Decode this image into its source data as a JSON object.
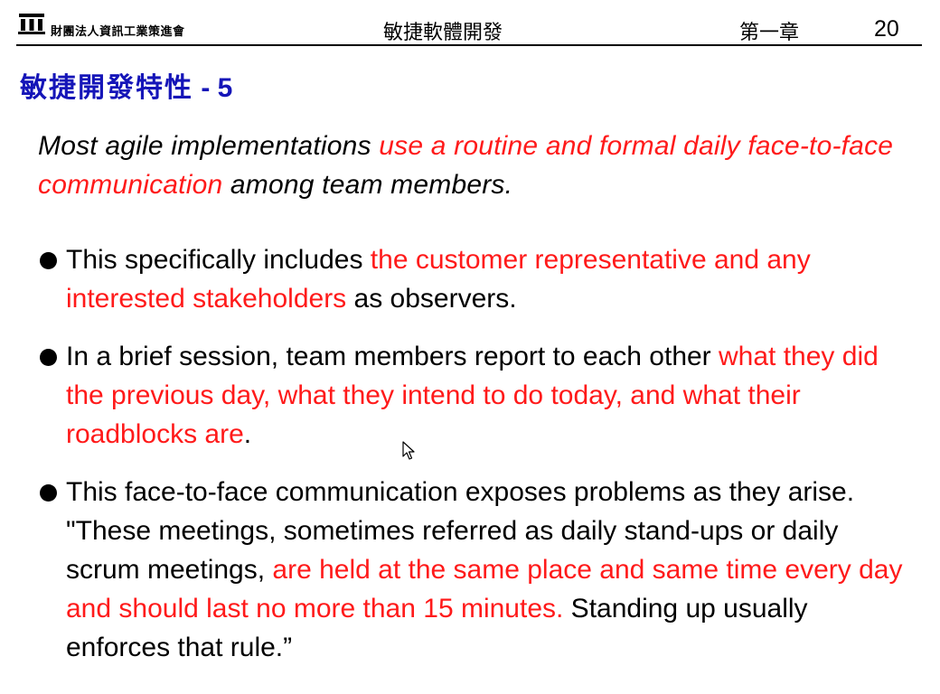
{
  "header": {
    "org_name": "財團法人資訊工業策進會",
    "course_title": "敏捷軟體開發",
    "chapter": "第一章",
    "page_number": "20"
  },
  "slide": {
    "title_zh": "敏捷開發特性",
    "title_suffix": " - 5",
    "intro": [
      {
        "text": "Most agile implementations ",
        "highlight": false
      },
      {
        "text": "use a routine and formal daily face-to-face communication",
        "highlight": true
      },
      {
        "text": " among team members.",
        "highlight": false
      }
    ],
    "bullets": [
      [
        {
          "text": "This specifically includes ",
          "highlight": false
        },
        {
          "text": "the customer representative and any interested stakeholders",
          "highlight": true
        },
        {
          "text": " as observers.",
          "highlight": false
        }
      ],
      [
        {
          "text": "In a brief session, team members report to each other ",
          "highlight": false
        },
        {
          "text": "what they did the previous day, what they intend to do today, and what their roadblocks are",
          "highlight": true
        },
        {
          "text": ".",
          "highlight": false
        }
      ],
      [
        {
          "text": "This face-to-face communication exposes problems as they arise. \"These meetings, sometimes referred as daily stand-ups or daily scrum meetings, ",
          "highlight": false
        },
        {
          "text": "are held at the same place and same time every day and should last no more than 15 minutes.",
          "highlight": true
        },
        {
          "text": " Standing up usually enforces that rule.”",
          "highlight": false
        }
      ]
    ]
  },
  "icons": {
    "logo": "institute-building-icon",
    "cursor": "mouse-pointer-icon"
  },
  "colors": {
    "title": "#1515b8",
    "highlight": "#ff1a1a",
    "text": "#000000"
  }
}
